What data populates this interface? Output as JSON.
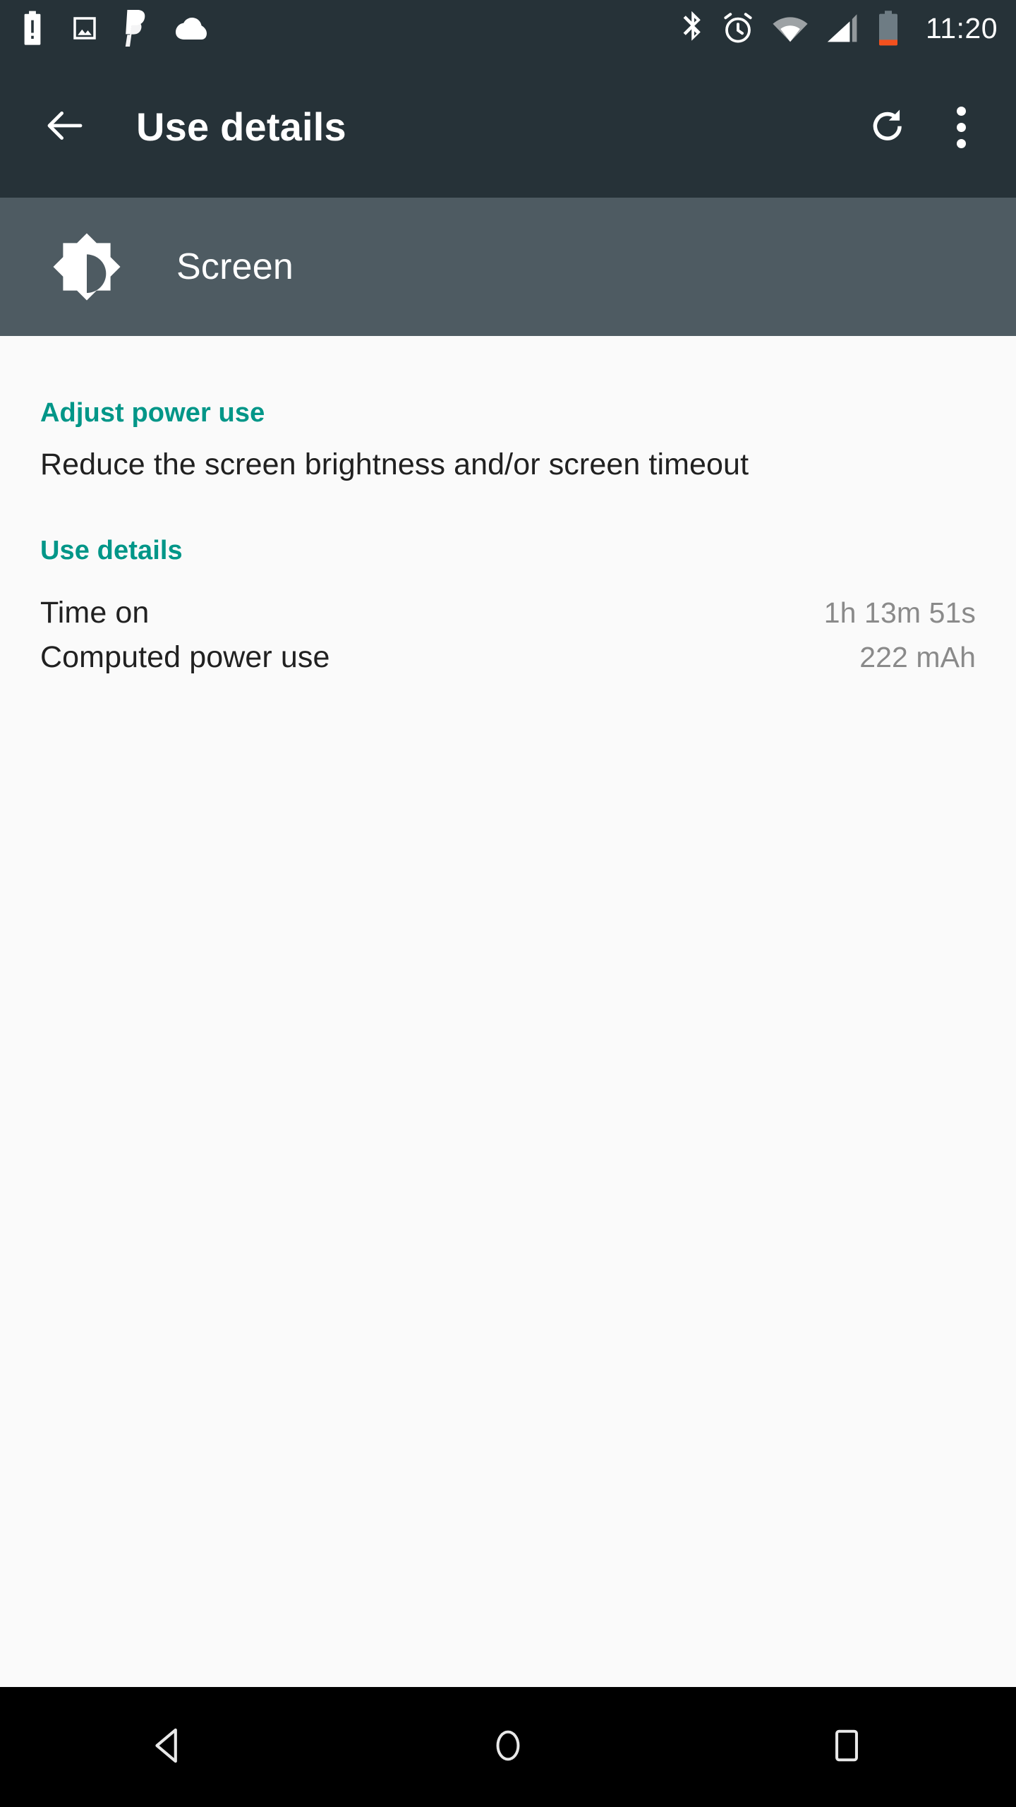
{
  "status_bar": {
    "left_icons": [
      {
        "name": "battery-alert-icon",
        "label": "battery alert"
      },
      {
        "name": "screenshot-image-icon",
        "label": "screenshot"
      },
      {
        "name": "paypal-icon",
        "label": "PayPal"
      },
      {
        "name": "cloud-icon",
        "label": "cloud sync"
      }
    ],
    "right_icons": [
      {
        "name": "bluetooth-icon",
        "label": "Bluetooth"
      },
      {
        "name": "alarm-clock-icon",
        "label": "Alarm set"
      },
      {
        "name": "wifi-icon",
        "label": "Wi-Fi"
      },
      {
        "name": "cellular-signal-icon",
        "label": "Cellular signal"
      },
      {
        "name": "battery-icon",
        "label": "Battery low"
      }
    ],
    "clock": "11:20",
    "background_color": "#263238",
    "battery_fill_color": "#F4511E"
  },
  "app_bar": {
    "title": "Use details",
    "back_icon": "arrow-back-icon",
    "refresh_icon": "refresh-icon",
    "overflow_icon": "more-vert-icon",
    "background_color": "#263238"
  },
  "entity_header": {
    "label": "Screen",
    "icon": "brightness-medium-icon",
    "background_color": "#4E5B62"
  },
  "content": {
    "background_color": "#FAFAFA",
    "accent_color": "#009688",
    "sections": [
      {
        "title": "Adjust power use",
        "body": "Reduce the screen brightness and/or screen timeout"
      },
      {
        "title": "Use details",
        "rows": [
          {
            "key": "Time on",
            "value": "1h 13m 51s"
          },
          {
            "key": "Computed power use",
            "value": "222 mAh"
          }
        ]
      }
    ]
  },
  "nav_bar": {
    "background_color": "#000000",
    "buttons": [
      {
        "name": "nav-back-button",
        "label": "Back"
      },
      {
        "name": "nav-home-button",
        "label": "Home"
      },
      {
        "name": "nav-recents-button",
        "label": "Recents"
      }
    ]
  }
}
